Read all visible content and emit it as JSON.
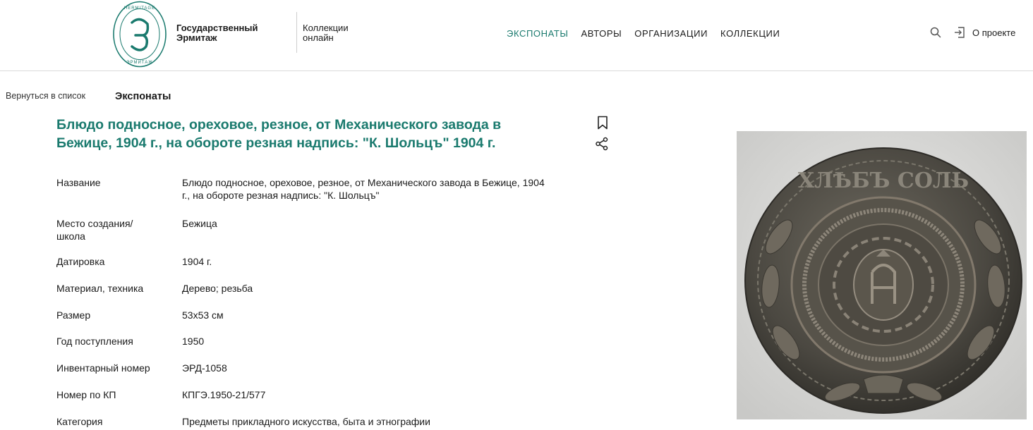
{
  "header": {
    "logo_text_top": "HERMITAGE",
    "logo_text_bottom": "ЭРМИТАЖ",
    "brand_line1": "Государственный",
    "brand_line2": "Эрмитаж",
    "collections_line1": "Коллекции",
    "collections_line2": "онлайн",
    "nav": [
      {
        "label": "ЭКСПОНАТЫ",
        "active": true
      },
      {
        "label": "АВТОРЫ",
        "active": false
      },
      {
        "label": "ОРГАНИЗАЦИИ",
        "active": false
      },
      {
        "label": "КОЛЛЕКЦИИ",
        "active": false
      }
    ],
    "about_label": "О проекте"
  },
  "breadcrumb": {
    "back_label": "Вернуться в список",
    "section_label": "Экспонаты"
  },
  "object": {
    "title": "Блюдо подносное, ореховое, резное, от Механического завода в Бежице, 1904 г., на обороте резная надпись: \"К. Шольцъ\" 1904 г.",
    "properties": [
      {
        "label": "Название",
        "value": "Блюдо подносное, ореховое, резное, от Механического завода в Бежице, 1904 г., на обороте резная надпись: \"К. Шольцъ\""
      },
      {
        "label": "Место создания/ школа",
        "value": "Бежица"
      },
      {
        "label": "Датировка",
        "value": "1904 г."
      },
      {
        "label": "Материал, техника",
        "value": "Дерево; резьба"
      },
      {
        "label": "Размер",
        "value": "53x53 см"
      },
      {
        "label": "Год поступления",
        "value": "1950"
      },
      {
        "label": "Инвентарный номер",
        "value": "ЭРД-1058"
      },
      {
        "label": "Номер по КП",
        "value": "КПГЭ.1950-21/577"
      },
      {
        "label": "Категория",
        "value": "Предметы прикладного искусства, быта и этнографии"
      }
    ],
    "plate_inscription": "ХЛѢБЪ СОЛЬ"
  },
  "colors": {
    "accent": "#1a7a6e",
    "text": "#1a1a1a",
    "divider": "#d9d9d9"
  }
}
